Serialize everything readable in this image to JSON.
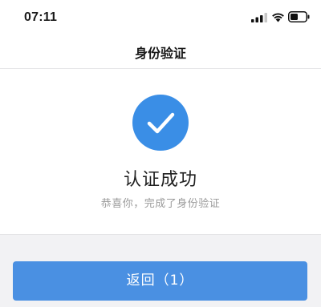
{
  "status_bar": {
    "time": "07:11",
    "icons": [
      "signal-icon",
      "wifi-icon",
      "battery-icon"
    ]
  },
  "nav": {
    "title": "身份验证"
  },
  "result": {
    "icon": "checkmark-icon",
    "title": "认证成功",
    "subtitle": "恭喜你，完成了身份验证"
  },
  "actions": {
    "back_label": "返回（1）"
  },
  "colors": {
    "accent": "#4a90e2",
    "success_circle": "#3a8ee6",
    "background": "#f2f2f4",
    "subtitle_text": "#9a9a9a"
  }
}
